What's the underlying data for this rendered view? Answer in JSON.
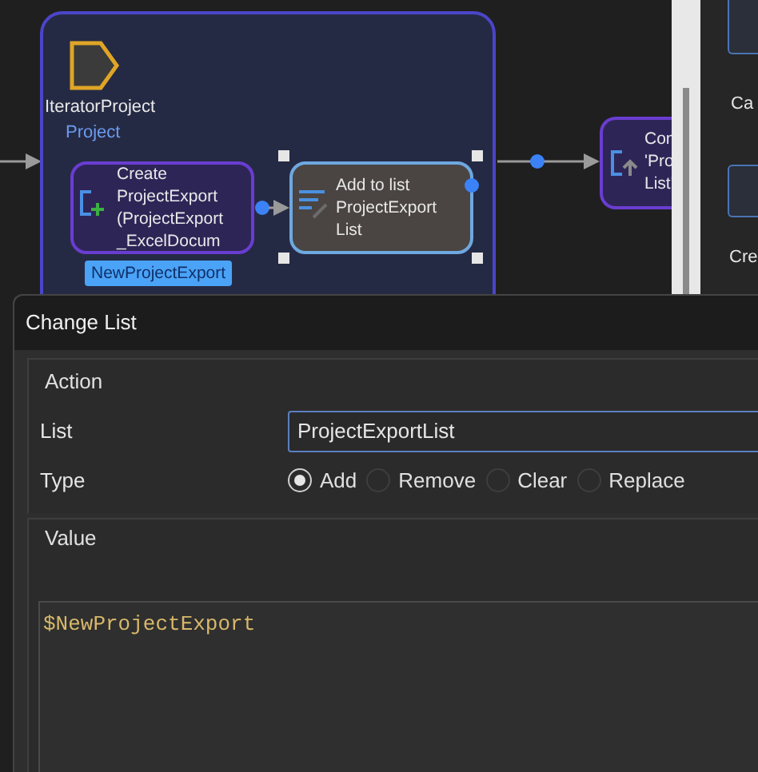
{
  "canvas": {
    "iterator": {
      "name": "IteratorProject",
      "type": "Project"
    },
    "create_node": {
      "lines": [
        "Create",
        "ProjectExport",
        "(ProjectExport",
        "_ExcelDocum"
      ],
      "badge": "NewProjectExport"
    },
    "add_node": {
      "lines": [
        "Add to list",
        "ProjectExport",
        "List"
      ],
      "selected": true
    },
    "next_node": {
      "lines": [
        "Con",
        "'Pro",
        "List'"
      ]
    }
  },
  "side_panel": {
    "items": [
      "Ca",
      "Cre"
    ]
  },
  "dialog": {
    "title": "Change List",
    "action": {
      "heading": "Action",
      "list_label": "List",
      "list_value": "ProjectExportList",
      "type_label": "Type",
      "types": [
        {
          "label": "Add",
          "selected": true
        },
        {
          "label": "Remove",
          "selected": false
        },
        {
          "label": "Clear",
          "selected": false
        },
        {
          "label": "Replace",
          "selected": false
        }
      ]
    },
    "value": {
      "heading": "Value",
      "expression": "$NewProjectExport"
    }
  }
}
